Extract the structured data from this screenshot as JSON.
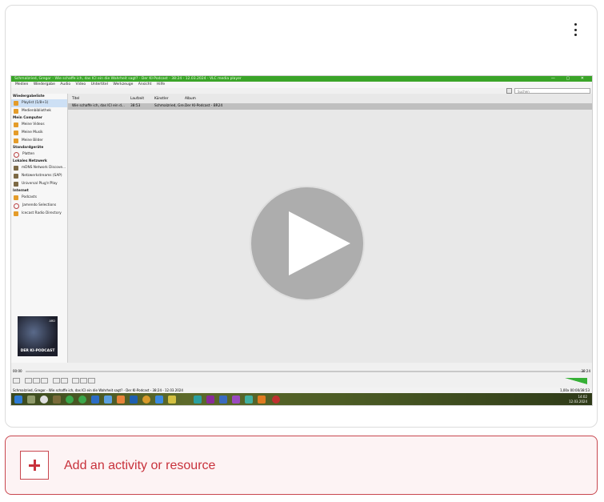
{
  "card": {
    "menu_icon": "kebab-menu-icon"
  },
  "player": {
    "window_title": "Schmalzried, Gregor - Wie schaffe ich, das ICI ein die Wahrheit sagt? - Der KI-Podcast - 38:24 - 12.03.2024 - VLC media player",
    "menu": [
      "Medien",
      "Wiedergabe",
      "Audio",
      "Video",
      "Untertitel",
      "Werkzeuge",
      "Ansicht",
      "Hilfe"
    ],
    "search_placeholder": "Suchen",
    "sidebar": [
      {
        "header": "Wiedergabeliste",
        "items": [
          {
            "label": "Playlist (1/8+1)",
            "icon": "playlist-icon",
            "selected": true
          },
          {
            "label": "Medienbibliothek",
            "icon": "library-icon"
          }
        ]
      },
      {
        "header": "Mein Computer",
        "items": [
          {
            "label": "Meine Videos",
            "icon": "video-icon"
          },
          {
            "label": "Meine Musik",
            "icon": "music-icon"
          },
          {
            "label": "Meine Bilder",
            "icon": "picture-icon"
          }
        ]
      },
      {
        "header": "Standardgeräte",
        "items": [
          {
            "label": "Platten",
            "icon": "disc-icon"
          }
        ]
      },
      {
        "header": "Lokales Netzwerk",
        "items": [
          {
            "label": "mDNS Network Discove...",
            "icon": "network-icon"
          },
          {
            "label": "Netzwerkstreams (SAP)",
            "icon": "network-icon"
          },
          {
            "label": "Universal Plug'n'Play",
            "icon": "network-icon"
          }
        ]
      },
      {
        "header": "Internet",
        "items": [
          {
            "label": "Podcasts",
            "icon": "podcast-icon"
          },
          {
            "label": "Jamendo Selections",
            "icon": "jamendo-icon"
          },
          {
            "label": "Icecast Radio Directory",
            "icon": "radio-icon"
          }
        ]
      }
    ],
    "cover_text": "DER KI-PODCAST",
    "cover_badge": "ARD",
    "table": {
      "headers": [
        "Titel",
        "Laufzeit",
        "Künstler",
        "Album"
      ],
      "rows": [
        [
          "Wie schaffe ich, das ICI ein d...",
          "38:53",
          "Schmalzried, Gre...",
          "Der KI-Podcast - BR24"
        ]
      ]
    },
    "time_elapsed": "00:00",
    "time_total": "38:24",
    "status_text": "Schmalzried, Gregor - Wie schaffe ich, das ICI ein die Wahrheit sagt? - Der KI-Podcast - 38:24 - 12.03.2024",
    "speed": "1,00x",
    "position": "00:00/38:53",
    "clock_time": "14:02",
    "clock_date": "12.03.2024"
  },
  "add_activity": {
    "label": "Add an activity or resource"
  }
}
